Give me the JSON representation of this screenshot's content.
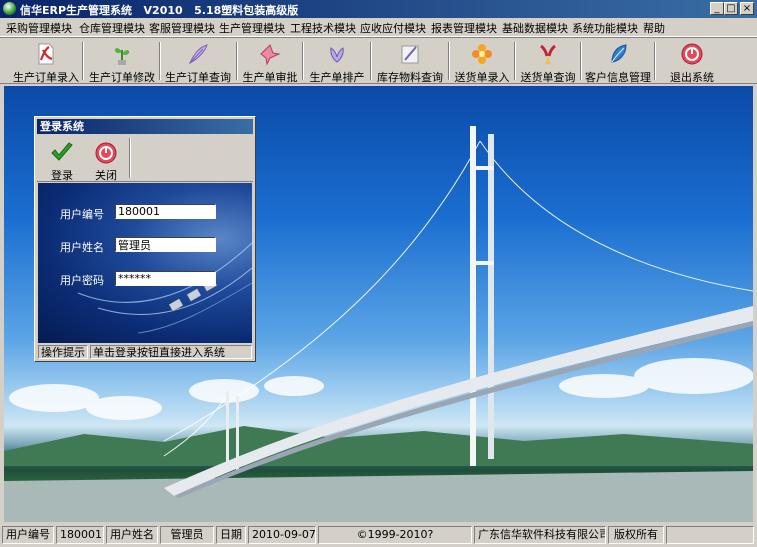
{
  "window": {
    "title": "信华ERP生产管理系统   V2010   5.18塑料包装高级版",
    "controls": {
      "minimize": "_",
      "maximize": "□",
      "close": "×"
    }
  },
  "menu": {
    "items": [
      "采购管理模块",
      "仓库管理模块",
      "客服管理模块",
      "生产管理模块",
      "工程技术模块",
      "应收应付模块",
      "报表管理模块",
      "基础数据模块",
      "系统功能模块",
      "帮助"
    ]
  },
  "toolbar": {
    "buttons": [
      {
        "label": "生产订单录入",
        "icon": "pdf-document-icon"
      },
      {
        "label": "生产订单修改",
        "icon": "plant-icon"
      },
      {
        "label": "生产订单查询",
        "icon": "feather-icon"
      },
      {
        "label": "生产单审批",
        "icon": "crane-icon"
      },
      {
        "label": "生产单排产",
        "icon": "lily-icon"
      },
      {
        "label": "库存物料查询",
        "icon": "quill-icon"
      },
      {
        "label": "送货单录入",
        "icon": "flower-icon"
      },
      {
        "label": "送货单查询",
        "icon": "bouquet-icon"
      },
      {
        "label": "客户信息管理",
        "icon": "leaf-icon"
      },
      {
        "label": "退出系统",
        "icon": "power-icon"
      }
    ]
  },
  "login": {
    "title": "登录系统",
    "buttons": {
      "login": "登录",
      "close": "关闭"
    },
    "fields": {
      "user_id_label": "用户编号",
      "user_id_value": "180001",
      "user_name_label": "用户姓名",
      "user_name_value": "管理员",
      "password_label": "用户密码",
      "password_value": "******"
    },
    "status": {
      "hint_label": "操作提示",
      "hint_text": "单击登录按钮直接进入系统"
    }
  },
  "statusbar": {
    "user_id_label": "用户编号",
    "user_id": "180001",
    "user_name_label": "用户姓名",
    "user_name": "管理员",
    "date_label": "日期",
    "date": "2010-09-07",
    "copyright": "©1999-2010?",
    "company": "广东信华软件科技有限公司",
    "rights": "版权所有"
  },
  "colors": {
    "titlebar": "#0a246a",
    "face": "#d4d0c8",
    "login_panel": "#0a2a72"
  }
}
